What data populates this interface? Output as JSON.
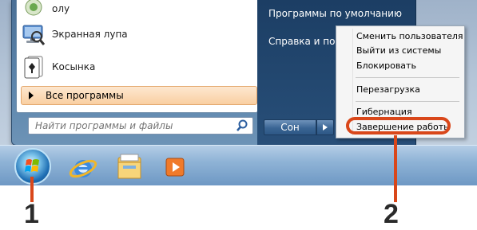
{
  "start_menu": {
    "programs": [
      {
        "label": "олу",
        "icon": "partial-app-icon"
      },
      {
        "label": "Экранная лупа",
        "icon": "magnifier-icon"
      },
      {
        "label": "Косынка",
        "icon": "solitaire-icon"
      }
    ],
    "all_programs": "Все программы",
    "search_placeholder": "Найти программы и файлы",
    "right_pane": [
      "Программы по умолчанию",
      "Справка и подд"
    ],
    "sleep_button": "Сон"
  },
  "power_submenu": {
    "items": [
      "Сменить пользователя",
      "Выйти из системы",
      "Блокировать",
      "Перезагрузка",
      "Гибернация",
      "Завершение работы"
    ]
  },
  "taskbar": {
    "items": [
      {
        "icon": "start-orb-icon"
      },
      {
        "icon": "internet-explorer-icon"
      },
      {
        "icon": "windows-explorer-icon"
      },
      {
        "icon": "media-player-icon"
      }
    ]
  },
  "callouts": [
    "1",
    "2"
  ],
  "colors": {
    "highlight": "#d9471a",
    "start_menu_blue": "#284f79",
    "all_programs_orange": "#f9cfa2"
  }
}
